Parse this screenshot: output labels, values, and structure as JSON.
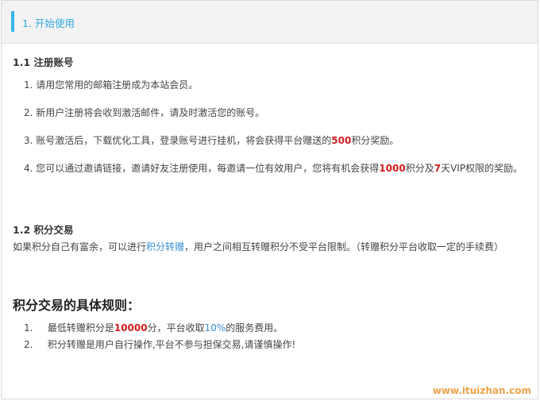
{
  "header": {
    "title": "1. 开始使用"
  },
  "section1": {
    "heading": "1.1 注册账号",
    "steps": [
      {
        "num": "1.",
        "text": "请用您常用的邮箱注册成为本站会员。"
      },
      {
        "num": "2.",
        "text": "新用户注册将会收到激活邮件，请及时激活您的账号。"
      },
      {
        "num": "3.",
        "pre": "账号激活后，下载优化工具，登录账号进行挂机，将会获得平台赠送的",
        "points": "500",
        "post": "积分奖励。"
      },
      {
        "num": "4.",
        "pre": "您可以通过邀请链接，邀请好友注册使用，每邀请一位有效用户，您将有机会获得",
        "points": "1000",
        "mid": "积分及",
        "days": "7",
        "post": "天VIP权限的奖励。"
      }
    ]
  },
  "section2": {
    "heading": "1.2 积分交易",
    "pre": "如果积分自己有富余，可以进行",
    "link": "积分转赠",
    "post": "，用户之间相互转赠积分不受平台限制。（转赠积分平台收取一定的手续费）"
  },
  "rules": {
    "title": "积分交易的具体规则：",
    "items": [
      {
        "num": "1.",
        "pre": "最低转赠积分是",
        "value": "10000",
        "mid": "分，平台收取",
        "rate": "10%",
        "post": "的服务费用。"
      },
      {
        "num": "2.",
        "text": "积分转赠是用户自行操作,平台不参与担保交易,请谨慎操作!"
      }
    ]
  },
  "watermark": "www.ituizhan.com",
  "colors": {
    "accent": "#35b6e9",
    "highlight": "#d21e1e",
    "link": "#3a8fd6",
    "watermark": "#f0a24a"
  }
}
